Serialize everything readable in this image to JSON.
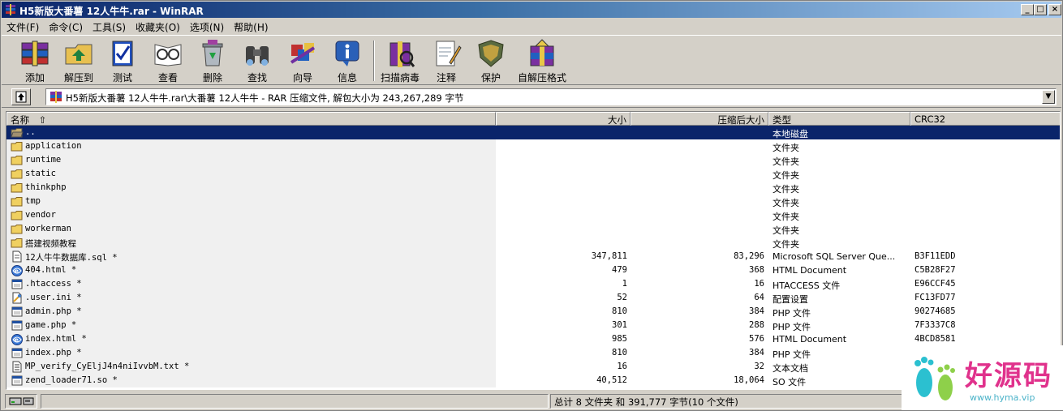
{
  "window": {
    "title": "H5新版大番薯 12人牛牛.rar - WinRAR",
    "controls": {
      "minimize": "_",
      "maximize": "□",
      "close": "×"
    }
  },
  "menu": [
    "文件(F)",
    "命令(C)",
    "工具(S)",
    "收藏夹(O)",
    "选项(N)",
    "帮助(H)"
  ],
  "toolbar": {
    "add": "添加",
    "extract": "解压到",
    "test": "测试",
    "view": "查看",
    "delete": "删除",
    "find": "查找",
    "wizard": "向导",
    "info": "信息",
    "scan": "扫描病毒",
    "comment": "注释",
    "protect": "保护",
    "sfx": "自解压格式"
  },
  "address": {
    "text": "H5新版大番薯 12人牛牛.rar\\大番薯 12人牛牛 - RAR 压缩文件, 解包大小为 243,267,289 字节",
    "dropdown": "▼"
  },
  "columns": {
    "name": "名称",
    "size": "大小",
    "packed": "压缩后大小",
    "type": "类型",
    "crc": "CRC32"
  },
  "files": [
    {
      "name": "..",
      "size": "",
      "packed": "",
      "type": "本地磁盘",
      "crc": "",
      "icon": "folder-open-icon"
    },
    {
      "name": "application",
      "size": "",
      "packed": "",
      "type": "文件夹",
      "crc": "",
      "icon": "folder-icon"
    },
    {
      "name": "runtime",
      "size": "",
      "packed": "",
      "type": "文件夹",
      "crc": "",
      "icon": "folder-icon"
    },
    {
      "name": "static",
      "size": "",
      "packed": "",
      "type": "文件夹",
      "crc": "",
      "icon": "folder-icon"
    },
    {
      "name": "thinkphp",
      "size": "",
      "packed": "",
      "type": "文件夹",
      "crc": "",
      "icon": "folder-icon"
    },
    {
      "name": "tmp",
      "size": "",
      "packed": "",
      "type": "文件夹",
      "crc": "",
      "icon": "folder-icon"
    },
    {
      "name": "vendor",
      "size": "",
      "packed": "",
      "type": "文件夹",
      "crc": "",
      "icon": "folder-icon"
    },
    {
      "name": "workerman",
      "size": "",
      "packed": "",
      "type": "文件夹",
      "crc": "",
      "icon": "folder-icon"
    },
    {
      "name": "搭建视频教程",
      "size": "",
      "packed": "",
      "type": "文件夹",
      "crc": "",
      "icon": "folder-icon"
    },
    {
      "name": "12人牛牛数据库.sql *",
      "size": "347,811",
      "packed": "83,296",
      "type": "Microsoft SQL Server Que...",
      "crc": "B3F11EDD",
      "icon": "document-icon"
    },
    {
      "name": "404.html *",
      "size": "479",
      "packed": "368",
      "type": "HTML Document",
      "crc": "C5B28F27",
      "icon": "html-icon"
    },
    {
      "name": ".htaccess *",
      "size": "1",
      "packed": "16",
      "type": "HTACCESS 文件",
      "crc": "E96CCF45",
      "icon": "file-icon"
    },
    {
      "name": ".user.ini *",
      "size": "52",
      "packed": "64",
      "type": "配置设置",
      "crc": "FC13FD77",
      "icon": "config-icon"
    },
    {
      "name": "admin.php *",
      "size": "810",
      "packed": "384",
      "type": "PHP 文件",
      "crc": "90274685",
      "icon": "file-icon"
    },
    {
      "name": "game.php *",
      "size": "301",
      "packed": "288",
      "type": "PHP 文件",
      "crc": "7F3337C8",
      "icon": "file-icon"
    },
    {
      "name": "index.html *",
      "size": "985",
      "packed": "576",
      "type": "HTML Document",
      "crc": "4BCD8581",
      "icon": "html-icon"
    },
    {
      "name": "index.php *",
      "size": "810",
      "packed": "384",
      "type": "PHP 文件",
      "crc": "",
      "icon": "file-icon"
    },
    {
      "name": "MP_verify_CyEljJ4n4niIvvbM.txt *",
      "size": "16",
      "packed": "32",
      "type": "文本文档",
      "crc": "",
      "icon": "text-icon"
    },
    {
      "name": "zend_loader71.so *",
      "size": "40,512",
      "packed": "18,064",
      "type": "SO 文件",
      "crc": "",
      "icon": "file-icon"
    }
  ],
  "status": {
    "summary": "总计 8 文件夹 和 391,777 字节(10 个文件)"
  },
  "watermark": {
    "text": "好源码",
    "url": "www.hyma.vip"
  }
}
